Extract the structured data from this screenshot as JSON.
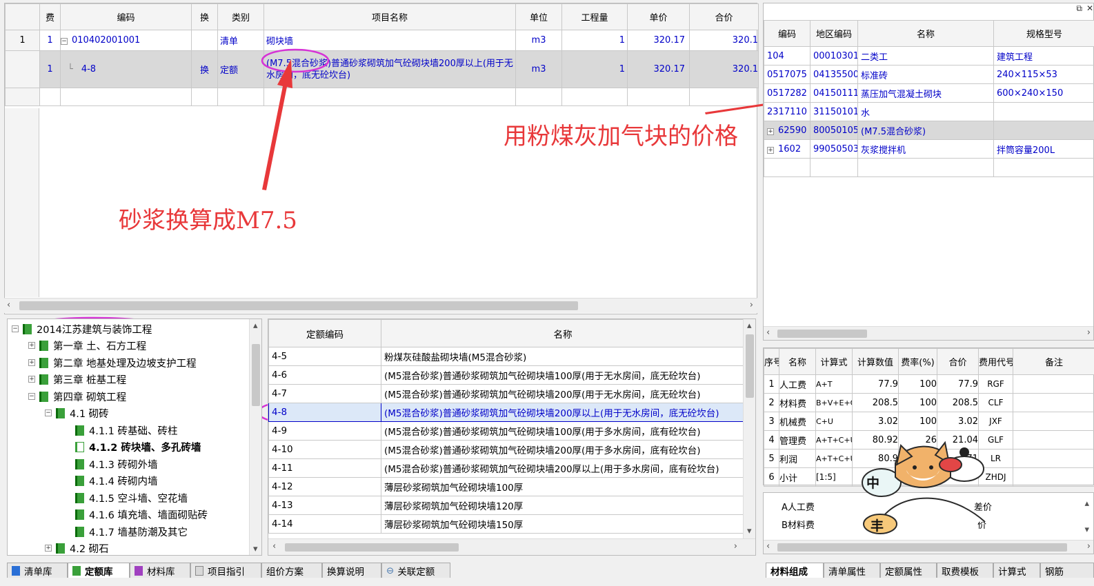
{
  "top_grid": {
    "headers": [
      "费",
      "编码",
      "换",
      "类别",
      "项目名称",
      "单位",
      "工程量",
      "单价",
      "合价"
    ],
    "rows": [
      {
        "num": "1",
        "fee": "1",
        "code": "010402001001",
        "huan": "",
        "type": "清单",
        "name": "砌块墙",
        "unit": "m3",
        "qty": "1",
        "price": "320.17",
        "total": "320.1"
      },
      {
        "num": "",
        "fee": "1",
        "code": "4-8",
        "huan": "换",
        "type": "定额",
        "name": "(M7.5混合砂浆)普通砂浆砌筑加气砼砌块墙200厚以上(用于无水房间，底无砼坎台)",
        "unit": "m3",
        "qty": "1",
        "price": "320.17",
        "total": "320.1"
      }
    ]
  },
  "annotations": {
    "mortar": "砂浆换算成M7.5",
    "flyash": "用粉煤灰加气块的价格"
  },
  "materials_grid": {
    "headers": [
      "编码",
      "地区编码",
      "名称",
      "规格型号"
    ],
    "rows": [
      {
        "code": "104",
        "region": "00010301",
        "name": "二类工",
        "spec": "建筑工程"
      },
      {
        "code": "0517075",
        "region": "04135500",
        "name": "标准砖",
        "spec": "240×115×53"
      },
      {
        "code": "0517282",
        "region": "04150111",
        "name": "蒸压加气混凝土砌块",
        "spec": "600×240×150"
      },
      {
        "code": "2317110",
        "region": "31150101",
        "name": "水",
        "spec": ""
      },
      {
        "code": "62590",
        "region": "80050105",
        "name": "(M7.5混合砂浆)",
        "spec": ""
      },
      {
        "code": "1602",
        "region": "99050503",
        "name": "灰浆搅拌机",
        "spec": "拌筒容量200L"
      }
    ]
  },
  "cost_grid": {
    "headers": [
      "序号",
      "名称",
      "计算式",
      "计算数值",
      "费率(%)",
      "合价",
      "费用代号",
      "备注"
    ],
    "rows": [
      {
        "n": "1",
        "name": "人工费",
        "formula": "A+T",
        "value": "77.9",
        "rate": "100",
        "total": "77.9",
        "code": "RGF"
      },
      {
        "n": "2",
        "name": "材料费",
        "formula": "B+V+E+Q-",
        "value": "208.5",
        "rate": "100",
        "total": "208.5",
        "code": "CLF"
      },
      {
        "n": "3",
        "name": "机械费",
        "formula": "C+U",
        "value": "3.02",
        "rate": "100",
        "total": "3.02",
        "code": "JXF"
      },
      {
        "n": "4",
        "name": "管理费",
        "formula": "A+T+C+U",
        "value": "80.92",
        "rate": "26",
        "total": "21.04",
        "code": "GLF"
      },
      {
        "n": "5",
        "name": "利润",
        "formula": "A+T+C+U",
        "value": "80.9",
        "rate": "",
        "total": "71",
        "code": "LR"
      },
      {
        "n": "6",
        "name": "小计",
        "formula": "[1:5]",
        "value": "",
        "rate": "",
        "total": "",
        "code": "ZHDJ"
      }
    ]
  },
  "bottom_right_list": {
    "items": [
      "A人工费",
      "B材料费"
    ],
    "side": [
      "差价",
      "价"
    ]
  },
  "tree": {
    "root": "2014江苏建筑与装饰工程",
    "items": [
      {
        "label": "第一章 土、石方工程"
      },
      {
        "label": "第二章 地基处理及边坡支护工程"
      },
      {
        "label": "第三章 桩基工程"
      },
      {
        "label": "第四章 砌筑工程"
      },
      {
        "label": "4.1  砌砖"
      },
      {
        "label": "4.1.1  砖基础、砖柱"
      },
      {
        "label": "4.1.2  砖块墙、多孔砖墙"
      },
      {
        "label": "4.1.3  砖砌外墙"
      },
      {
        "label": "4.1.4  砖砌内墙"
      },
      {
        "label": "4.1.5  空斗墙、空花墙"
      },
      {
        "label": "4.1.6  填充墙、墙面砌贴砖"
      },
      {
        "label": "4.1.7  墙基防潮及其它"
      },
      {
        "label": "4.2  砌石"
      }
    ]
  },
  "quota_grid": {
    "headers": [
      "定额编码",
      "名称"
    ],
    "rows": [
      {
        "code": "4-5",
        "name": "粉煤灰硅酸盐砌块墙(M5混合砂浆)"
      },
      {
        "code": "4-6",
        "name": "(M5混合砂浆)普通砂浆砌筑加气砼砌块墙100厚(用于无水房间，底无砼坎台)"
      },
      {
        "code": "4-7",
        "name": "(M5混合砂浆)普通砂浆砌筑加气砼砌块墙200厚(用于无水房间，底无砼坎台)"
      },
      {
        "code": "4-8",
        "name": "(M5混合砂浆)普通砂浆砌筑加气砼砌块墙200厚以上(用于无水房间，底无砼坎台)"
      },
      {
        "code": "4-9",
        "name": "(M5混合砂浆)普通砂浆砌筑加气砼砌块墙100厚(用于多水房间，底有砼坎台)"
      },
      {
        "code": "4-10",
        "name": "(M5混合砂浆)普通砂浆砌筑加气砼砌块墙200厚(用于多水房间，底有砼坎台)"
      },
      {
        "code": "4-11",
        "name": "(M5混合砂浆)普通砂浆砌筑加气砼砌块墙200厚以上(用于多水房间，底有砼坎台)"
      },
      {
        "code": "4-12",
        "name": "薄层砂浆砌筑加气砼砌块墙100厚"
      },
      {
        "code": "4-13",
        "name": "薄层砂浆砌筑加气砼砌块墙120厚"
      },
      {
        "code": "4-14",
        "name": "薄层砂浆砌筑加气砼砌块墙150厚"
      }
    ]
  },
  "bottom_tabs": [
    "清单库",
    "定额库",
    "材料库",
    "项目指引",
    "组价方案",
    "换算说明",
    "关联定额"
  ],
  "right_tabs": [
    "材料组成",
    "清单属性",
    "定额属性",
    "取费模板",
    "计算式",
    "钢筋"
  ],
  "mascot": {
    "left_badge": "中",
    "right_badge": "丰"
  },
  "colors": {
    "accent_annotation": "#e8383a",
    "highlight_circle": "#d633d6",
    "selected_row": "#d9d9d9",
    "link_blue": "#0000c8"
  }
}
